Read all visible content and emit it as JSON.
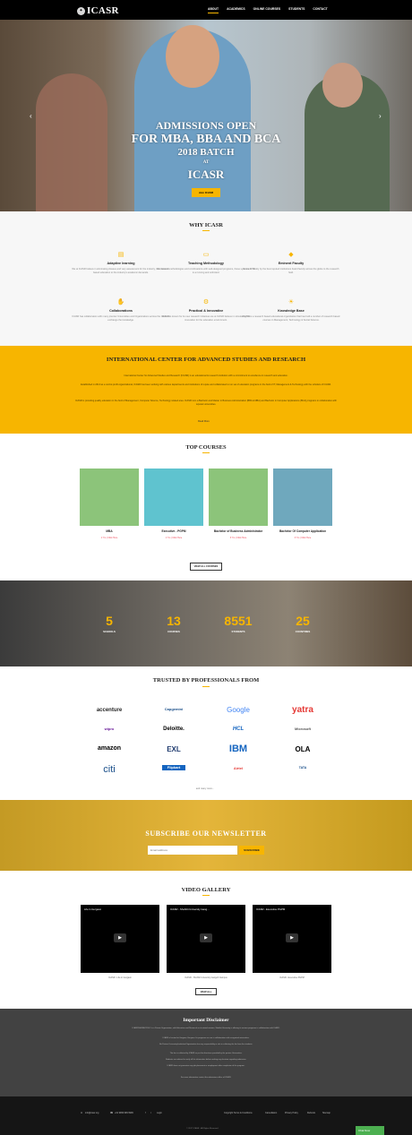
{
  "nav": {
    "logo": "ICASR",
    "items": [
      "ABOUT",
      "ACADEMICS",
      "ONLINE COURSES",
      "STUDENTS",
      "CONTACT"
    ]
  },
  "hero": {
    "line1": "ADMISSIONS OPEN",
    "line2": "FOR MBA, BBA AND BCA",
    "line3": "2018 BATCH",
    "line4": "AT",
    "line5": "ICASR",
    "button": "Join ICASR"
  },
  "why": {
    "title": "WHY ICASR",
    "features": [
      {
        "icon": "book-icon",
        "title": "Adaptive learning",
        "desc": "We at ICASR believe in eliminating classes and vary assessment for the industry, the research-based education to the industry's academic demands."
      },
      {
        "icon": "laptop-icon",
        "title": "Teaching Methodology",
        "desc": "We believe methodologies and combinations with well-designed programs, these systems ICTS is a running and unlimited."
      },
      {
        "icon": "graduation-cap-icon",
        "title": "Eminent Faculty",
        "desc": "Eminent faculty by the best reputed institutions board faculty across the globe to the research field."
      },
      {
        "icon": "handshake-icon",
        "title": "Collaborations",
        "desc": "ICASR has collaboration with many premier Universities and Organizations across the Globe to exchange the knowledge."
      },
      {
        "icon": "gears-icon",
        "title": "Practical & Innovative",
        "desc": "ICASR is known for its new research Initiatives we at ICASR believe in stimulating the innovation for the education environment."
      },
      {
        "icon": "lightbulb-icon",
        "title": "Knowledge Base",
        "desc": "ICASR is a research based educational organization that has built a number of research based courses in Management, Technology & Social Science."
      }
    ]
  },
  "intl": {
    "title": "INTERNATIONAL CENTER FOR ADVANCED STUDIES AND RESEARCH",
    "p1": "International Center for Advanced Studies and Research (ICASR) is an educational & research institution with a commitment to excellence in research and education.",
    "p2": "Established in 2013 as a not-for-profit organizational, ICASR has been working with various departments and institutions of repute and collaborated to run set of education programs in the field of IT, Management & Technology with the scholars of ICASR.",
    "p3": "ICASR is providing quality education in the field of Management, Computer Science, Technology related area. ICASR runs a Bachelor and Master in Business Administration (BBA & MBA) and Bachelor in Computer Applications (BCA) programs in collaboration with reputed universities.",
    "more": "Read More"
  },
  "courses": {
    "title": "TOP COURSES",
    "items": [
      {
        "name": "MBA",
        "meta": "1 Yrs  |  Click Here"
      },
      {
        "name": "Executive - PGPM",
        "meta": "1 Yrs  |  Click Here"
      },
      {
        "name": "Bachelor of Business Administrator",
        "meta": "3 Yrs  |  Click Here"
      },
      {
        "name": "Bachelor Of Computer Application",
        "meta": "3 Yrs  |  Click Here"
      }
    ],
    "view_all": "VIEW ALL COURSES"
  },
  "stats": [
    {
      "value": "5",
      "label": "SCHOOLS"
    },
    {
      "value": "13",
      "label": "COURSES"
    },
    {
      "value": "8551",
      "label": "STUDENTS"
    },
    {
      "value": "25",
      "label": "COUNTRIES"
    }
  ],
  "trust": {
    "title": "TRUSTED BY PROFESSIONALS FROM",
    "logos": [
      "accenture",
      "Capgemini",
      "Google",
      "yatra",
      "wipro",
      "Deloitte.",
      "HCL",
      "Microsoft",
      "amazon",
      "EXL",
      "IBM",
      "OLA",
      "citi",
      "Flipkart",
      "Airtel",
      "TATA"
    ],
    "more": "and many more..."
  },
  "newsletter": {
    "title": "SUBSCRIBE OUR NEWSLETTER",
    "placeholder": "Email address",
    "button": "SUBSCRIBE"
  },
  "gallery": {
    "title": "VIDEO GALLERY",
    "videos": [
      {
        "title": "Life in Gurgaon",
        "caption": "ICASR - Life in Gurgaon"
      },
      {
        "title": "ICASR - Shobhit University Gang...",
        "caption": "ICASR - Shobhit University Gangoh Campus"
      },
      {
        "title": "ICASR - Executive PGPM",
        "caption": "ICASR - Executive PGPM"
      }
    ],
    "view_all": "VIEW ALL"
  },
  "disclaimer": {
    "title": "Important Disclaimer",
    "lines": [
      "ICASR/SHOBHIT/GLC is a Private Organization, with Education and Research as its stated mission, Shobhit University is offering its various programs in collaboration with ICASR.",
      "ICASR is located at Gurgaon, Haryana. Its programs are run in collaboration with recognized universities.",
      "No Partner University/institution/Organization has any responsibility or role in collecting the fee from the students.",
      "The fee is collected by ICASR as per the directions provided by the partner Universities.",
      "Students are advised to verify all the information before making any decision regarding admission.",
      "ICASR does not guarantee any job placement or employment after completion of the program.",
      "For more information contact the admissions office of ICASR."
    ]
  },
  "footer": {
    "email": "info@icasr.org",
    "phone": "+91 9999 999 9999",
    "login": "Login",
    "links": [
      "Copyright Terms & Conditions",
      "Cancellation",
      "Privacy Policy",
      "Refunds",
      "Sitemap"
    ],
    "copyright": "© 2017 ICASR - All Rights Reserved",
    "chat": "Chat Now"
  }
}
